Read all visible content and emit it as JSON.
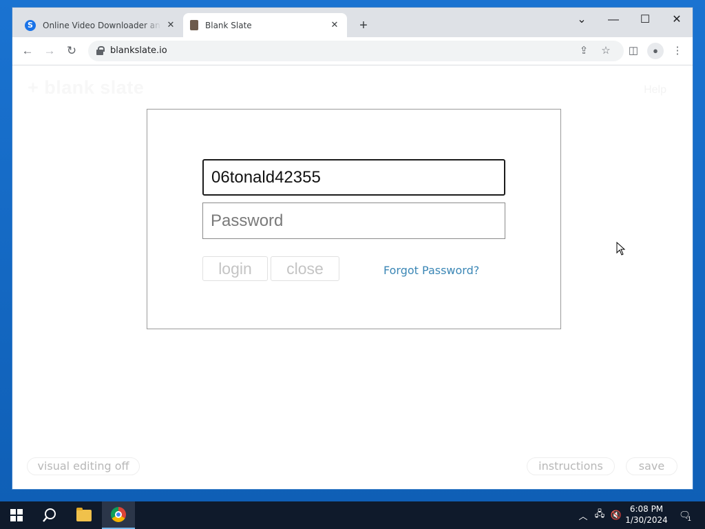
{
  "browser": {
    "tabs": [
      {
        "title": "Online Video Downloader and C",
        "favicon_letter": "S",
        "active": false
      },
      {
        "title": "Blank Slate",
        "active": true
      }
    ],
    "url": "blankslate.io"
  },
  "page": {
    "logo": "+ blank slate",
    "ghost_right": "Help",
    "login_modal": {
      "username_value": "06tonald42355",
      "password_placeholder": "Password",
      "login_label": "login",
      "close_label": "close",
      "forgot_label": "Forgot Password?"
    },
    "footer": {
      "visual_editing_label": "visual editing off",
      "instructions_label": "instructions",
      "save_label": "save"
    }
  },
  "taskbar": {
    "time": "6:08 PM",
    "date": "1/30/2024",
    "notification_count": "1"
  },
  "colors": {
    "link": "#3a86b5",
    "taskbar": "#0f1a2b",
    "desktop": "#1a73d1"
  }
}
